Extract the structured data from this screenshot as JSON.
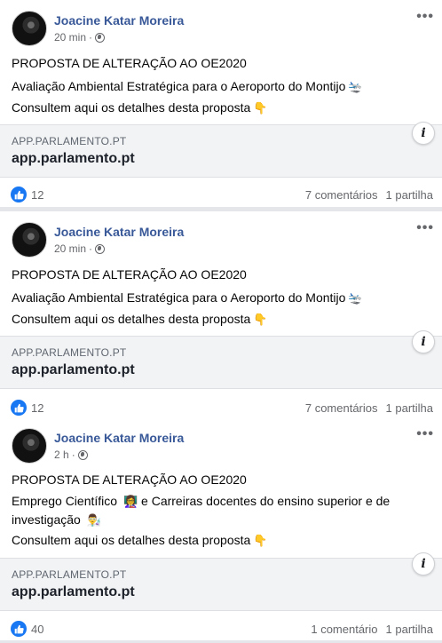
{
  "posts": [
    {
      "author": "Joacine Katar Moreira",
      "time": "20 min",
      "more": "•••",
      "lines": [
        "PROPOSTA DE ALTERAÇÃO AO OE2020",
        "Avaliação Ambiental Estratégica para o Aeroporto do Montijo",
        "Consultem aqui os detalhes desta proposta"
      ],
      "emojis": [
        "🛬",
        "👇"
      ],
      "link": {
        "domain": "APP.PARLAMENTO.PT",
        "title": "app.parlamento.pt",
        "info": "i"
      },
      "likes": "12",
      "comments": "7 comentários",
      "shares": "1 partilha"
    },
    {
      "author": "Joacine Katar Moreira",
      "time": "20 min",
      "more": "•••",
      "lines": [
        "PROPOSTA DE ALTERAÇÃO AO OE2020",
        "Avaliação Ambiental Estratégica para o Aeroporto do Montijo",
        "Consultem aqui os detalhes desta proposta"
      ],
      "emojis": [
        "🛬",
        "👇"
      ],
      "link": {
        "domain": "APP.PARLAMENTO.PT",
        "title": "app.parlamento.pt",
        "info": "i"
      },
      "likes": "12",
      "comments": "7 comentários",
      "shares": "1 partilha"
    },
    {
      "author": "Joacine Katar Moreira",
      "time": "2 h",
      "more": "•••",
      "lines": [
        "PROPOSTA DE ALTERAÇÃO AO OE2020",
        "Emprego Científico",
        "e Carreiras docentes do ensino superior e de investigação",
        "Consultem aqui os detalhes desta proposta"
      ],
      "emojis": [
        "👩‍🏫",
        "👨‍🔬",
        "👇"
      ],
      "link": {
        "domain": "APP.PARLAMENTO.PT",
        "title": "app.parlamento.pt",
        "info": "i"
      },
      "likes": "40",
      "comments": "1 comentário",
      "shares": "1 partilha"
    }
  ],
  "colors": {
    "author": "#385898",
    "like": "#1877f2",
    "muted": "#65676b",
    "card_bg": "#f2f3f5"
  },
  "icons": [
    "globe-icon",
    "more-options-icon",
    "info-icon",
    "like-icon"
  ]
}
